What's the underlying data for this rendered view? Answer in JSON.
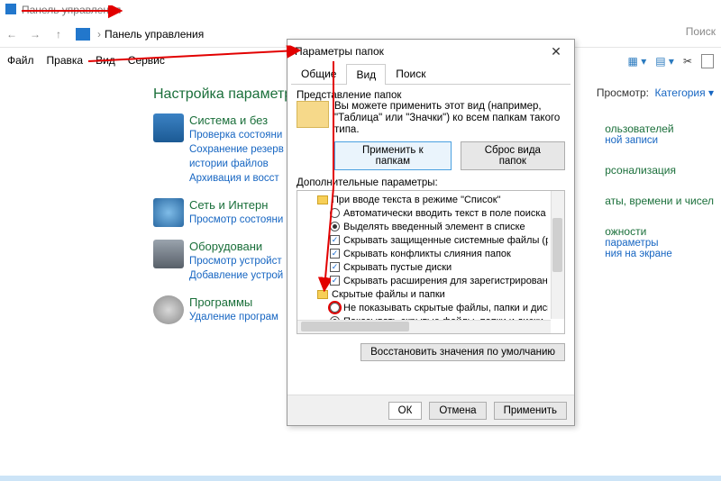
{
  "window": {
    "title": "Панель управления"
  },
  "nav": {
    "breadcrumb": "Панель управления",
    "search_placeholder": "Поиск"
  },
  "menu": {
    "file": "Файл",
    "edit": "Правка",
    "view": "Вид",
    "service": "Сервис"
  },
  "content": {
    "title": "Настройка параметров",
    "categories": [
      {
        "head": "Система и без",
        "links": [
          "Проверка состояни",
          "Сохранение резерв",
          "истории файлов",
          "Архивация и восст"
        ]
      },
      {
        "head": "Сеть и Интерн",
        "links": [
          "Просмотр состояни"
        ]
      },
      {
        "head": "Оборудовани",
        "links": [
          "Просмотр устройст",
          "Добавление устрой"
        ]
      },
      {
        "head": "Программы",
        "links": [
          "Удаление програм"
        ]
      }
    ]
  },
  "view_by": {
    "label": "Просмотр:",
    "value": "Категория ▾"
  },
  "right": [
    {
      "head": "ользователей",
      "sub": "ной записи"
    },
    {
      "head": "рсонализация",
      "sub": ""
    },
    {
      "head": "аты, времени и чисел",
      "sub": ""
    },
    {
      "head": "ожности",
      "sub1": "параметры",
      "sub2": "ния на экране"
    }
  ],
  "dialog": {
    "title": "Параметры папок",
    "tabs": {
      "general": "Общие",
      "view": "Вид",
      "search": "Поиск"
    },
    "repr_label": "Представление папок",
    "repr_text": "Вы можете применить этот вид (например, \"Таблица\" или \"Значки\") ко всем папкам такого типа.",
    "btn_apply_folders": "Применить к папкам",
    "btn_reset_folders": "Сброс вида папок",
    "advanced_label": "Дополнительные параметры:",
    "tree": [
      {
        "type": "folder",
        "text": "При вводе текста в режиме \"Список\""
      },
      {
        "type": "radio",
        "checked": false,
        "text": "Автоматически вводить текст в поле поиска"
      },
      {
        "type": "radio",
        "checked": true,
        "text": "Выделять введенный элемент в списке"
      },
      {
        "type": "check",
        "checked": true,
        "text": "Скрывать защищенные системные файлы (рекомен."
      },
      {
        "type": "check",
        "checked": true,
        "text": "Скрывать конфликты слияния папок"
      },
      {
        "type": "check",
        "checked": true,
        "text": "Скрывать пустые диски"
      },
      {
        "type": "check",
        "checked": true,
        "text": "Скрывать расширения для зарегистрированных типо"
      },
      {
        "type": "folder",
        "text": "Скрытые файлы и папки"
      },
      {
        "type": "radio",
        "checked": false,
        "text": "Не показывать скрытые файлы, папки и диски",
        "highlight": true
      },
      {
        "type": "radio",
        "checked": true,
        "text": "Показывать скрытые файлы, папки и диски"
      }
    ],
    "btn_restore": "Восстановить значения по умолчанию",
    "btn_ok": "ОК",
    "btn_cancel": "Отмена",
    "btn_apply": "Применить"
  }
}
